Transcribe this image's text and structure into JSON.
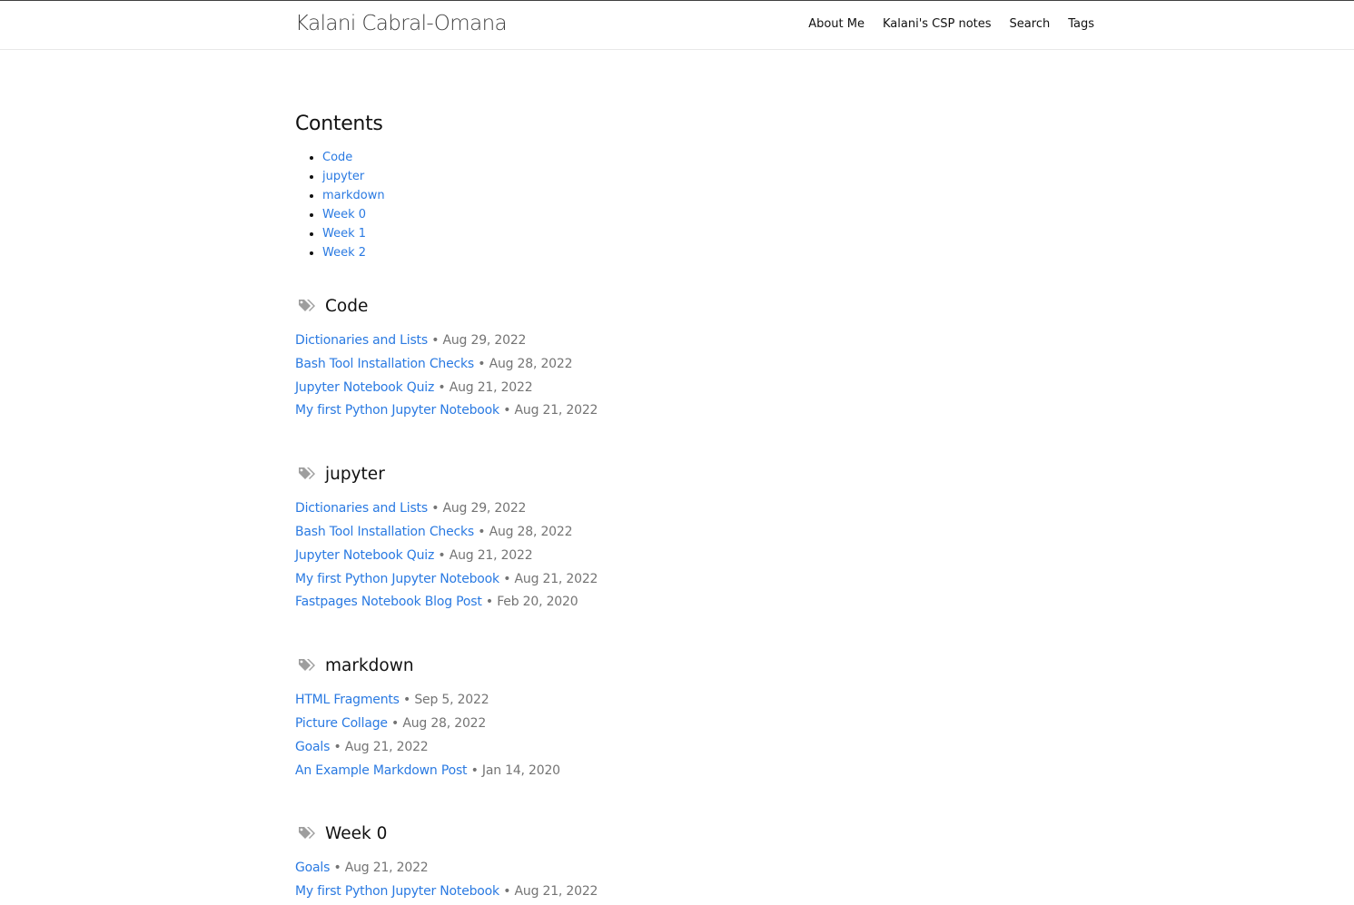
{
  "site": {
    "title": "Kalani Cabral-Omana"
  },
  "nav": [
    "About Me",
    "Kalani's CSP notes",
    "Search",
    "Tags"
  ],
  "contents": {
    "heading": "Contents",
    "items": [
      "Code",
      "jupyter",
      "markdown",
      "Week 0",
      "Week 1",
      "Week 2"
    ]
  },
  "icons": {
    "tag": "tags-icon"
  },
  "colors": {
    "link": "#2a7ae2",
    "meta": "#747474",
    "icon": "#9e9e9e"
  },
  "sections": [
    {
      "name": "Code",
      "posts": [
        {
          "title": "Dictionaries and Lists",
          "date": "Aug 29, 2022"
        },
        {
          "title": "Bash Tool Installation Checks",
          "date": "Aug 28, 2022"
        },
        {
          "title": "Jupyter Notebook Quiz",
          "date": "Aug 21, 2022"
        },
        {
          "title": "My first Python Jupyter Notebook",
          "date": "Aug 21, 2022"
        }
      ]
    },
    {
      "name": "jupyter",
      "posts": [
        {
          "title": "Dictionaries and Lists",
          "date": "Aug 29, 2022"
        },
        {
          "title": "Bash Tool Installation Checks",
          "date": "Aug 28, 2022"
        },
        {
          "title": "Jupyter Notebook Quiz",
          "date": "Aug 21, 2022"
        },
        {
          "title": "My first Python Jupyter Notebook",
          "date": "Aug 21, 2022"
        },
        {
          "title": "Fastpages Notebook Blog Post",
          "date": "Feb 20, 2020"
        }
      ]
    },
    {
      "name": "markdown",
      "posts": [
        {
          "title": "HTML Fragments",
          "date": "Sep 5, 2022"
        },
        {
          "title": "Picture Collage",
          "date": "Aug 28, 2022"
        },
        {
          "title": "Goals",
          "date": "Aug 21, 2022"
        },
        {
          "title": "An Example Markdown Post",
          "date": "Jan 14, 2020"
        }
      ]
    },
    {
      "name": "Week 0",
      "posts": [
        {
          "title": "Goals",
          "date": "Aug 21, 2022"
        },
        {
          "title": "My first Python Jupyter Notebook",
          "date": "Aug 21, 2022"
        }
      ]
    }
  ]
}
